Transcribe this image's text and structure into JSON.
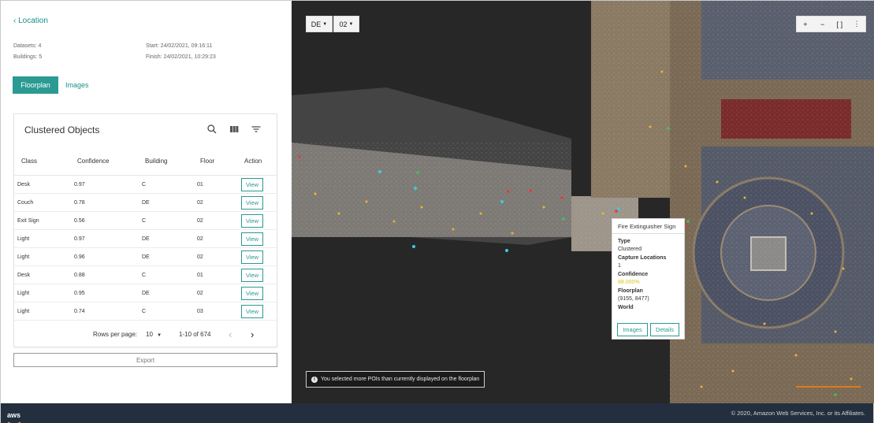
{
  "nav": {
    "back_label": "‹ Location"
  },
  "summary": {
    "datasets": "Datasets: 4",
    "buildings": "Buildings: 5",
    "start": "Start: 24/02/2021, 09:16:11",
    "finish": "Finish: 24/02/2021, 10:29:23"
  },
  "tabs": [
    {
      "label": "Floorplan",
      "active": true
    },
    {
      "label": "Images",
      "active": false
    }
  ],
  "table": {
    "title": "Clustered Objects",
    "icons": [
      "search-icon",
      "columns-icon",
      "filter-icon"
    ],
    "columns": [
      "Class",
      "Confidence",
      "Building",
      "Floor",
      "Action"
    ],
    "rows": [
      {
        "class": "Desk",
        "confidence": "0.97",
        "building": "C",
        "floor": "01",
        "action": "View"
      },
      {
        "class": "Couch",
        "confidence": "0.78",
        "building": "DE",
        "floor": "02",
        "action": "View"
      },
      {
        "class": "Exit Sign",
        "confidence": "0.56",
        "building": "C",
        "floor": "02",
        "action": "View"
      },
      {
        "class": "Light",
        "confidence": "0.97",
        "building": "DE",
        "floor": "02",
        "action": "View"
      },
      {
        "class": "Light",
        "confidence": "0.96",
        "building": "DE",
        "floor": "02",
        "action": "View"
      },
      {
        "class": "Desk",
        "confidence": "0.88",
        "building": "C",
        "floor": "01",
        "action": "View"
      },
      {
        "class": "Light",
        "confidence": "0.95",
        "building": "DE",
        "floor": "02",
        "action": "View"
      },
      {
        "class": "Light",
        "confidence": "0.74",
        "building": "C",
        "floor": "03",
        "action": "View"
      }
    ],
    "pagination": {
      "rows_per_page_label": "Rows per page:",
      "rows_per_page_value": "10",
      "range": "1-10 of 674",
      "prev": "‹",
      "next": "›"
    }
  },
  "export_label": "Export",
  "map": {
    "building_select": "DE",
    "floor_select": "02",
    "zoom_controls": [
      "+",
      "−",
      "[ ]",
      "⋮"
    ],
    "popup": {
      "title": "Fire Extinguisher Sign",
      "type_label": "Type",
      "type_value": "Clustered",
      "capture_label": "Capture Locations",
      "capture_value": "1",
      "confidence_label": "Confidence",
      "confidence_value": "88.000%",
      "floorplan_label": "Floorplan",
      "floorplan_value": "(9155, 8477)",
      "world_label": "World",
      "images_button": "Images",
      "details_button": "Details"
    },
    "notice": "You selected more POIs than currently displayed on the floorplan"
  },
  "footer": {
    "logo": "aws",
    "copyright": "© 2020, Amazon Web Services, Inc. or its Affiliates."
  },
  "colors": {
    "accent": "#2a9a92",
    "footer": "#232f3e",
    "confidence": "#d7c61a"
  }
}
